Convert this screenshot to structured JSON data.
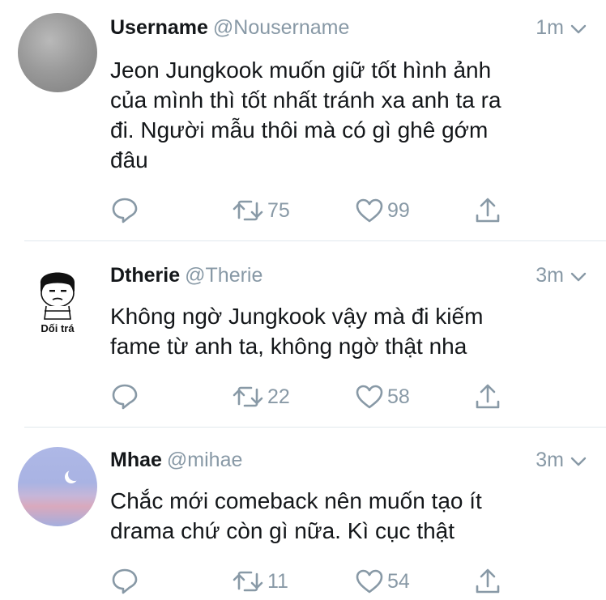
{
  "tweets": [
    {
      "name": "Username",
      "handle": "@Nousername",
      "time": "1m",
      "text_lines": [
        "Jeon Jungkook muốn giữ tốt hình ảnh",
        "của mình thì tốt nhất tránh xa anh ta ra",
        "đi. Người mẫu thôi mà có gì ghê gớm",
        "đâu"
      ],
      "retweets": "75",
      "likes": "99"
    },
    {
      "name": "Dtherie",
      "handle": "@Therie",
      "time": "3m",
      "avatar_caption": "Dối trá",
      "text_lines": [
        "Không ngờ Jungkook vậy mà đi kiếm",
        "fame từ anh ta, không ngờ thật nha"
      ],
      "retweets": "22",
      "likes": "58"
    },
    {
      "name": "Mhae",
      "handle": "@mihae",
      "time": "3m",
      "text_lines": [
        "Chắc mới comeback nên muốn tạo ít",
        "drama chứ còn gì nữa. Kì cục thật"
      ],
      "retweets": "11",
      "likes": "54"
    }
  ],
  "icons": {
    "reply": "reply-icon",
    "retweet": "retweet-icon",
    "like": "like-icon",
    "share": "share-icon",
    "more": "chevron-down-icon"
  },
  "colors": {
    "name": "#14171a",
    "secondary": "#8899a6",
    "divider": "#e1e8ed"
  }
}
